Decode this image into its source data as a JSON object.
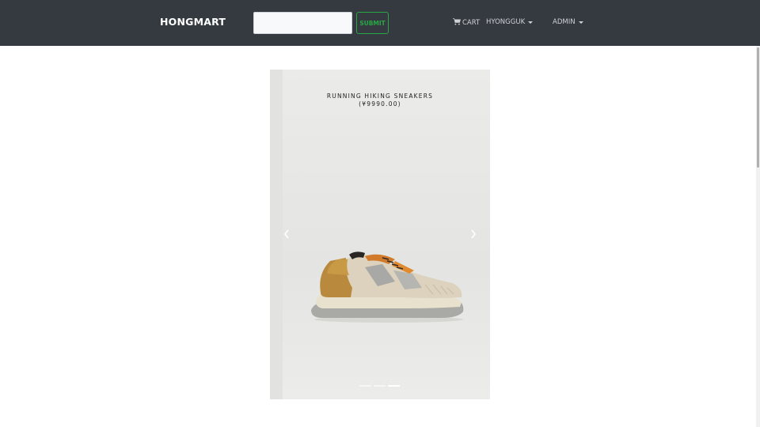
{
  "navbar": {
    "brand": "HONGMART",
    "search": {
      "value": "",
      "placeholder": ""
    },
    "submit_label": "SUBMIT",
    "cart_label": "CART",
    "user_label": "HYONGGUK",
    "admin_label": "ADMIN"
  },
  "carousel": {
    "product_name": "RUNNING HIKING SNEAKERS",
    "product_price": "(¥9990.00)",
    "slide_count": 3,
    "active_slide": 3,
    "controls": {
      "prev_icon": "chevron-left-icon",
      "next_icon": "chevron-right-icon"
    }
  },
  "colors": {
    "navbar_bg": "#343a40",
    "submit_accent": "#28a745",
    "page_bg": "#ffffff"
  }
}
